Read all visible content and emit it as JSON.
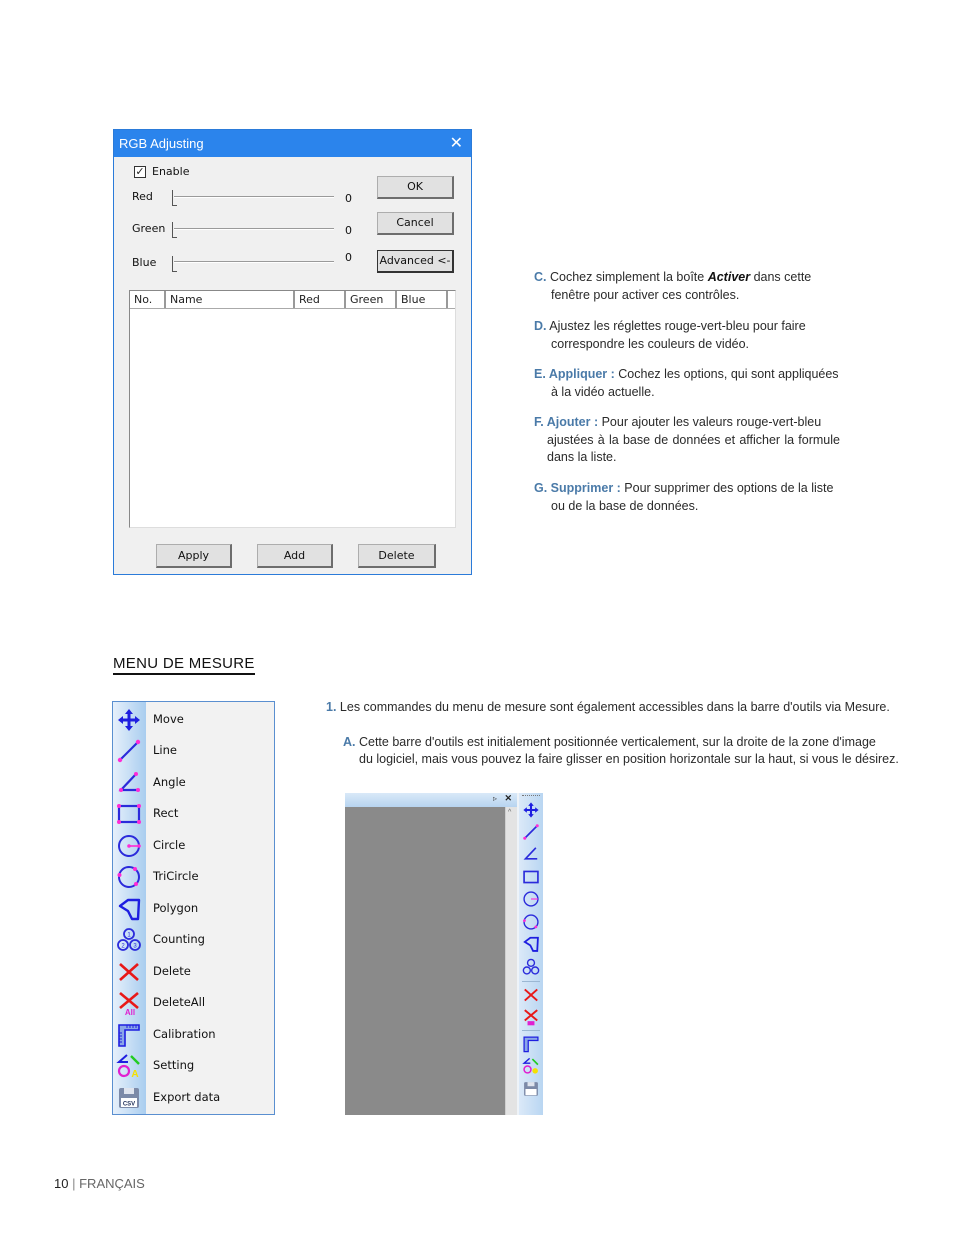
{
  "dialog": {
    "title": "RGB Adjusting",
    "close_glyph": "✕",
    "enable_label": "Enable",
    "enable_checked": true,
    "sliders": [
      {
        "label": "Red",
        "value": "0"
      },
      {
        "label": "Green",
        "value": "0"
      },
      {
        "label": "Blue",
        "value": "0"
      }
    ],
    "buttons": {
      "ok": "OK",
      "cancel": "Cancel",
      "advanced": "Advanced <-"
    },
    "list_columns": [
      "No.",
      "Name",
      "Red",
      "Green",
      "Blue"
    ],
    "bottom_buttons": {
      "apply": "Apply",
      "add": "Add",
      "delete": "Delete"
    }
  },
  "descriptions": [
    {
      "key": "C.",
      "text_pre": "Cochez simplement la boîte ",
      "em": "Activer",
      "text_post": " dans cette",
      "cont": "fenêtre pour activer ces contrôles."
    },
    {
      "key": "D.",
      "text": "Ajustez les réglettes rouge-vert-bleu pour faire",
      "cont": "correspondre les couleurs de vidéo."
    },
    {
      "key": "E. Appliquer :",
      "text": " Cochez les options, qui sont appliquées",
      "cont": "à la vidéo actuelle."
    },
    {
      "key": "F. Ajouter :",
      "text": " Pour ajouter les valeurs rouge-vert-bleu",
      "cont": "ajustées à la base de données et afficher la formule dans la liste."
    },
    {
      "key": "G. Supprimer :",
      "text": " Pour supprimer des options de la liste",
      "cont": "ou de la base de données."
    }
  ],
  "section_title": "MENU DE MESURE",
  "menu": {
    "items": [
      {
        "label": "Move",
        "icon": "move-icon"
      },
      {
        "label": "Line",
        "icon": "line-icon"
      },
      {
        "label": "Angle",
        "icon": "angle-icon"
      },
      {
        "label": "Rect",
        "icon": "rect-icon"
      },
      {
        "label": "Circle",
        "icon": "circle-icon"
      },
      {
        "label": "TriCircle",
        "icon": "tricircle-icon"
      },
      {
        "label": "Polygon",
        "icon": "polygon-icon"
      },
      {
        "label": "Counting",
        "icon": "counting-icon"
      },
      {
        "label": "Delete",
        "icon": "delete-icon"
      },
      {
        "label": "DeleteAll",
        "icon": "delete-all-icon"
      },
      {
        "label": "Calibration",
        "icon": "calibration-icon"
      },
      {
        "label": "Setting",
        "icon": "setting-icon"
      },
      {
        "label": "Export data",
        "icon": "export-csv-icon"
      }
    ]
  },
  "para1": {
    "key": "1.",
    "text": "Les commandes du menu de mesure sont également accessibles dans la barre d'outils via Mesure."
  },
  "paraA": {
    "key": "A.",
    "text": "Cette barre d'outils est initialement positionnée verticalement, sur la droite de la zone d'image",
    "cont": "du logiciel, mais vous pouvez la faire glisser en position horizontale sur la haut, si vous le désirez."
  },
  "toolbar_shot": {
    "pin_glyph": "▹",
    "close_glyph": "✕",
    "scroll_up_glyph": "^"
  },
  "footer": {
    "page": "10",
    "separator": "|",
    "language": "FRANÇAIS"
  },
  "csv_label": "CSV",
  "all_label": "All"
}
